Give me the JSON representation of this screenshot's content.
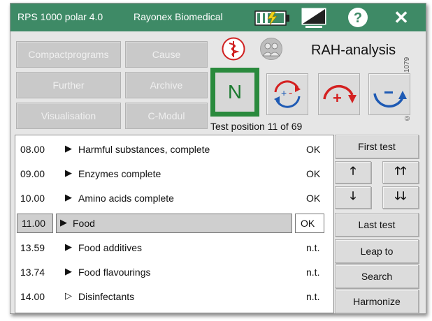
{
  "titlebar": {
    "app_name": "RPS 1000 polar 4.0",
    "vendor": "Rayonex Biomedical",
    "icons": [
      "battery-charging-icon",
      "display-brightness-icon",
      "help-icon",
      "close-icon"
    ],
    "help_glyph": "?",
    "close_glyph": "✕",
    "color": "#3e8a66"
  },
  "nav_buttons": {
    "compactprograms": "Compactprograms",
    "cause": "Cause",
    "further": "Further",
    "archive": "Archive",
    "visualisation": "Visualisation",
    "c_modul": "C-Modul"
  },
  "analysis": {
    "title": "RAH-analysis",
    "n_label": "N",
    "test_position": "Test position 11 of 69",
    "copyright": "© by Rayonex-1079"
  },
  "tests": [
    {
      "code": "08.00",
      "arrow": "▶",
      "name": "Harmful substances, complete",
      "status": "OK"
    },
    {
      "code": "09.00",
      "arrow": "▶",
      "name": "Enzymes complete",
      "status": "OK"
    },
    {
      "code": "10.00",
      "arrow": "▶",
      "name": "Amino acids complete",
      "status": "OK"
    },
    {
      "code": "11.00",
      "arrow": "▶",
      "name": "Food",
      "status": "OK",
      "selected": true
    },
    {
      "code": "13.59",
      "arrow": "▶",
      "name": "Food additives",
      "status": "n.t."
    },
    {
      "code": "13.74",
      "arrow": "▶",
      "name": "Food flavourings",
      "status": "n.t."
    },
    {
      "code": "14.00",
      "arrow": "▷",
      "name": "Disinfectants",
      "status": "n.t."
    }
  ],
  "side_buttons": {
    "first_test": "First test",
    "up": "🡑",
    "up_fast": "🡑🡑",
    "down": "🡓",
    "down_fast": "🡓🡓",
    "last_test": "Last test",
    "leap_to": "Leap to",
    "search": "Search",
    "harmonize": "Harmonize"
  }
}
